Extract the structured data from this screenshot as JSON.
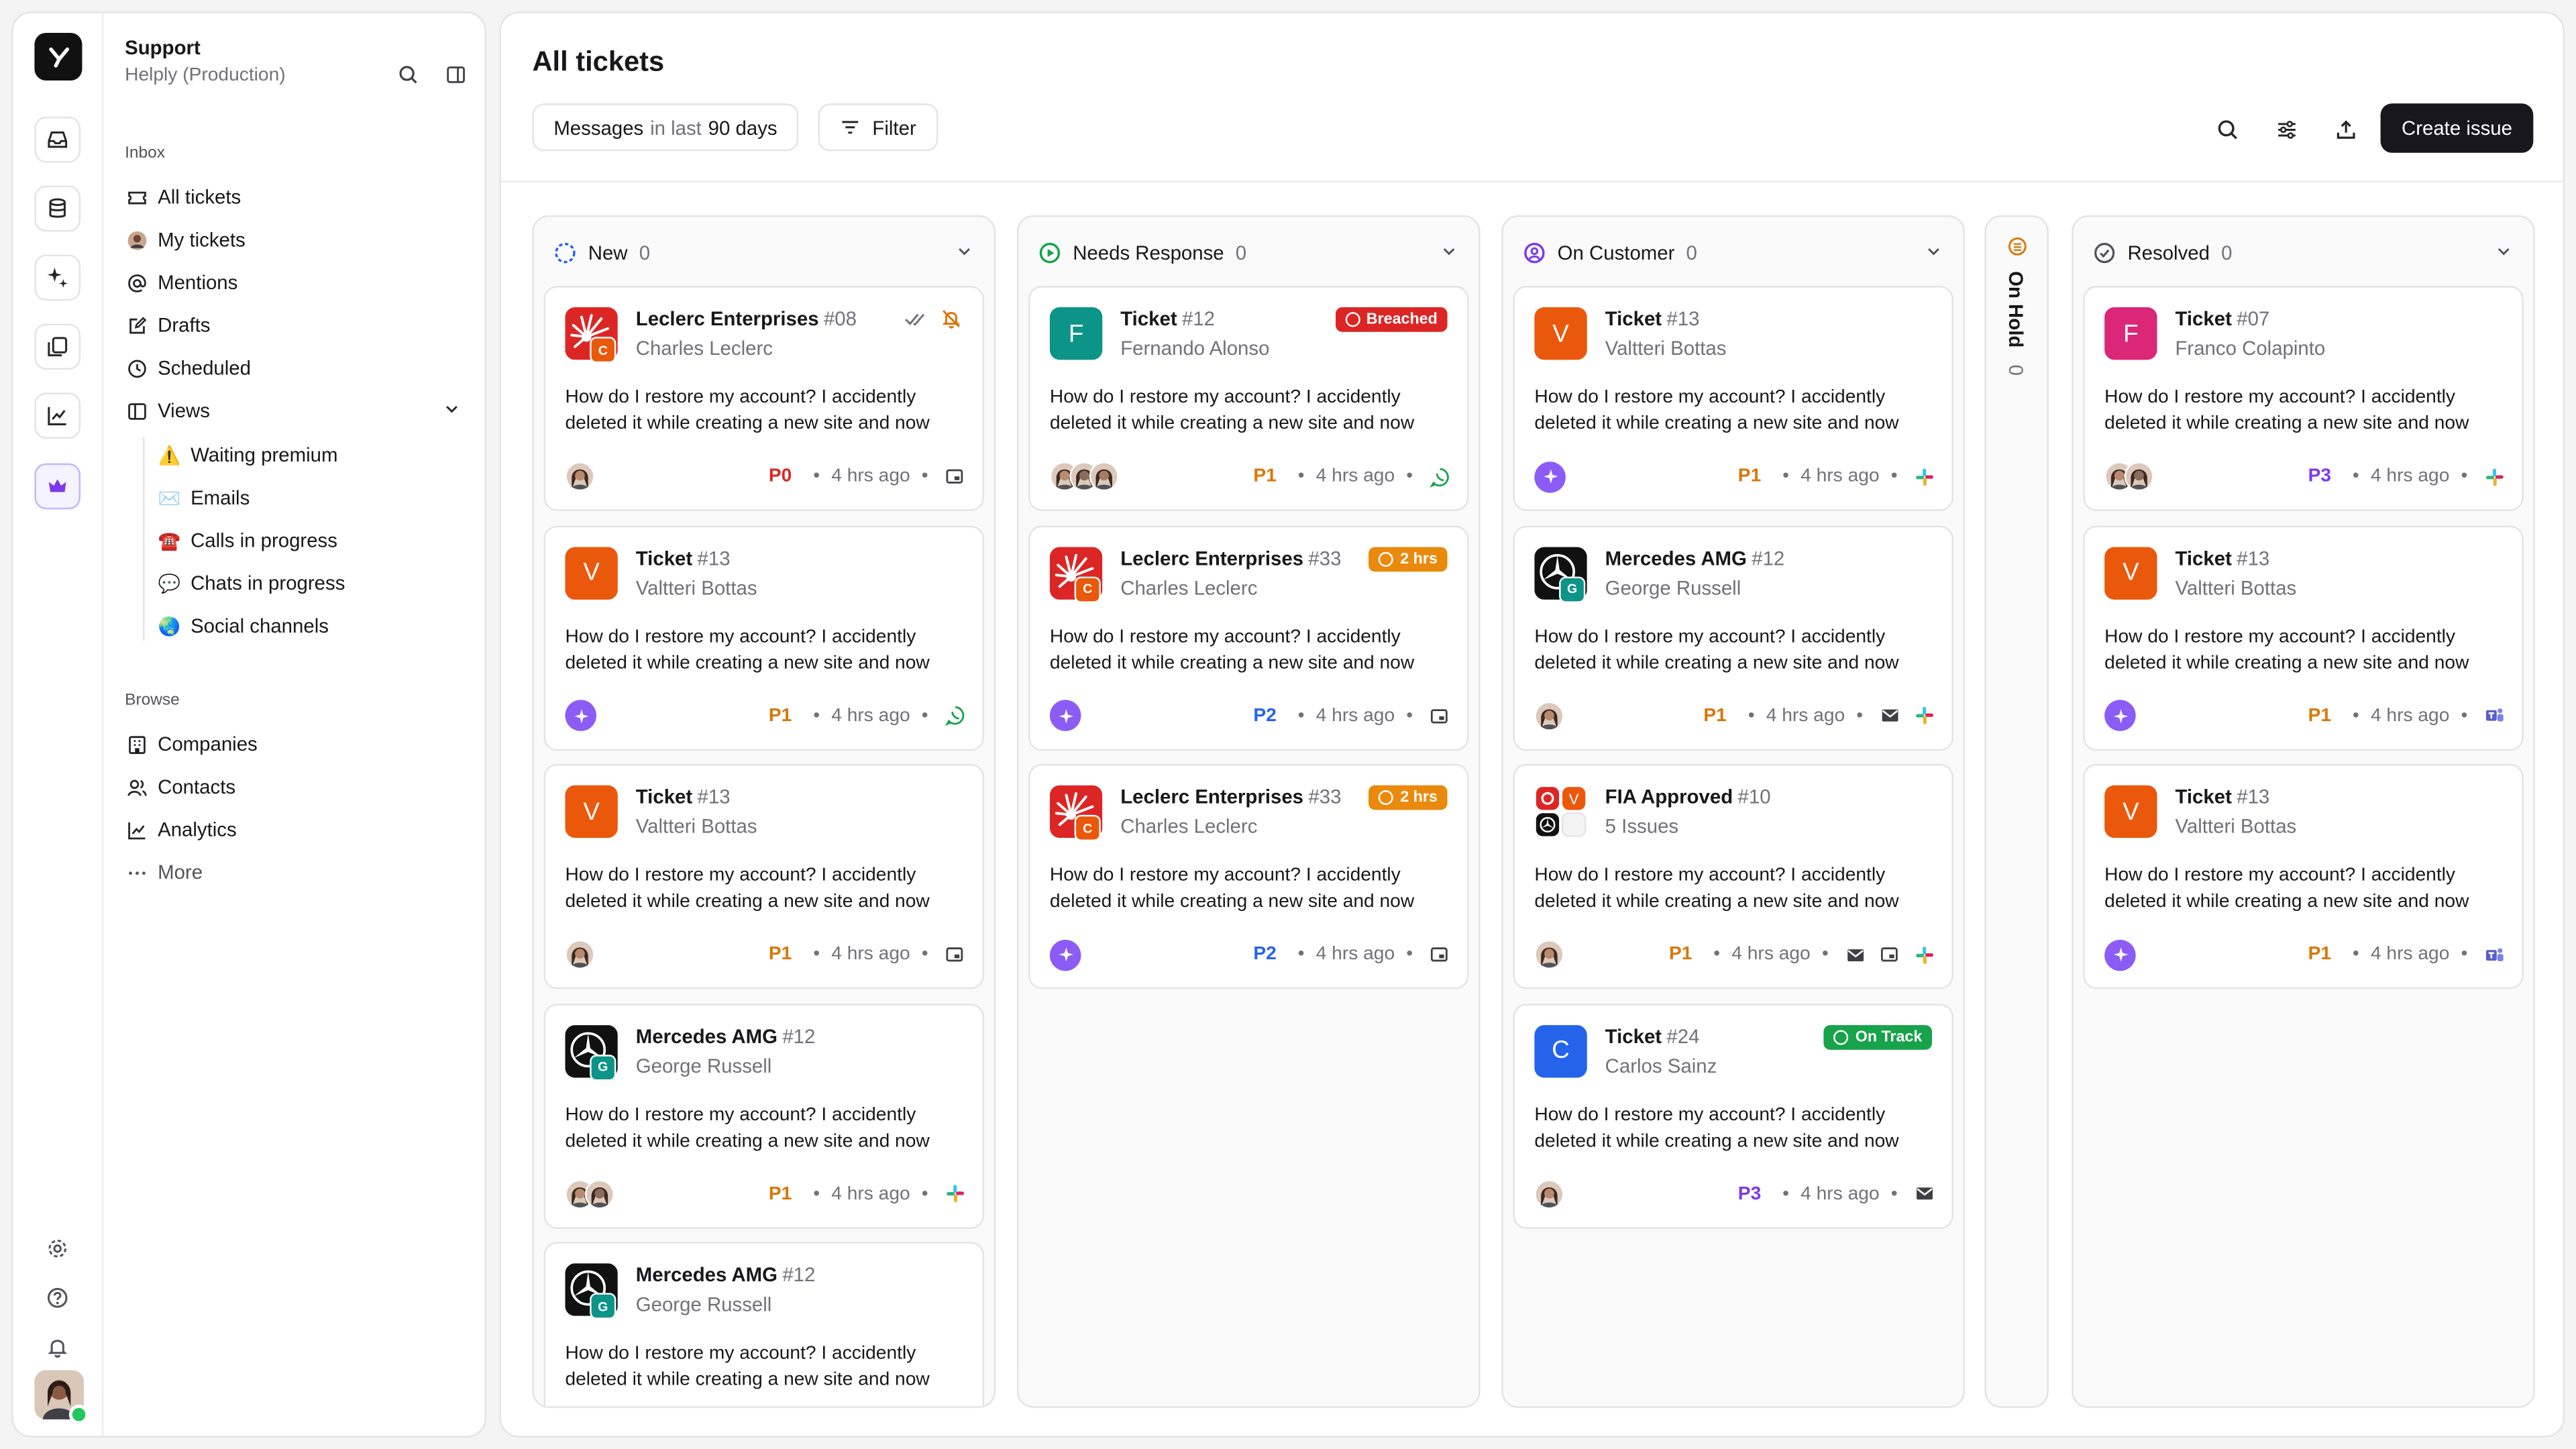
{
  "workspace": {
    "title": "Support",
    "subtitle": "Helply (Production)"
  },
  "nav": {
    "inbox_label": "Inbox",
    "inbox_items": [
      {
        "label": "All tickets",
        "icon": "ticket-icon"
      },
      {
        "label": "My tickets",
        "icon": "avatar-icon"
      },
      {
        "label": "Mentions",
        "icon": "at-icon"
      },
      {
        "label": "Drafts",
        "icon": "edit-icon"
      },
      {
        "label": "Scheduled",
        "icon": "clock-icon"
      },
      {
        "label": "Views",
        "icon": "columns-icon"
      }
    ],
    "views": [
      {
        "label": "Waiting premium",
        "emoji": "⚠️"
      },
      {
        "label": "Emails",
        "emoji": "✉️"
      },
      {
        "label": "Calls in progress",
        "emoji": "☎️"
      },
      {
        "label": "Chats in progress",
        "emoji": "💬"
      },
      {
        "label": "Social channels",
        "emoji": "🌏"
      }
    ],
    "browse_label": "Browse",
    "browse_items": [
      {
        "label": "Companies",
        "icon": "building-icon"
      },
      {
        "label": "Contacts",
        "icon": "users-icon"
      },
      {
        "label": "Analytics",
        "icon": "chart-icon"
      },
      {
        "label": "More",
        "icon": "more-icon"
      }
    ]
  },
  "header": {
    "title": "All tickets",
    "filter_prefix": "Messages",
    "filter_mid": "in last",
    "filter_value": "90 days",
    "filter_label": "Filter",
    "create_label": "Create issue"
  },
  "colors": {
    "p0": "#dc2626",
    "p1": "#d97706",
    "p2": "#2563eb",
    "p3": "#7c3aed",
    "breached": "#dc2626",
    "time": "#ea8a0c",
    "ontrack": "#16a34a",
    "accent": "#8b5cf6"
  },
  "columns": [
    {
      "name": "New",
      "count": "0",
      "icon": "new-status-icon",
      "cards": [
        {
          "title": "Leclerc Enterprises",
          "num": "#08",
          "sub": "Charles Leclerc",
          "avatar": "logo-leclerc",
          "sub_letter": "C",
          "sub_color": "#ea580c",
          "body": "How do I restore my account? I accidently deleted it while creating a new site and now",
          "people": 1,
          "priority": "P0",
          "pc": "#dc2626",
          "time": "4 hrs ago",
          "channels": [
            "chat-icon"
          ],
          "actions": true
        },
        {
          "title": "Ticket",
          "num": "#13",
          "sub": "Valtteri Bottas",
          "avatar": "letter",
          "letter": "V",
          "color": "#ea580c",
          "body": "How do I restore my account? I accidently deleted it while creating a new site and now",
          "ai": true,
          "priority": "P1",
          "pc": "#d97706",
          "time": "4 hrs ago",
          "channels": [
            "whatsapp-icon"
          ]
        },
        {
          "title": "Ticket",
          "num": "#13",
          "sub": "Valtteri Bottas",
          "avatar": "letter",
          "letter": "V",
          "color": "#ea580c",
          "body": "How do I restore my account? I accidently deleted it while creating a new site and now",
          "people": 1,
          "priority": "P1",
          "pc": "#d97706",
          "time": "4 hrs ago",
          "channels": [
            "chat-icon"
          ]
        },
        {
          "title": "Mercedes AMG",
          "num": "#12",
          "sub": "George Russell",
          "avatar": "logo-mercedes",
          "sub_letter": "G",
          "sub_color": "#0d9488",
          "body": "How do I restore my account? I accidently deleted it while creating a new site and now",
          "people": 2,
          "priority": "P1",
          "pc": "#d97706",
          "time": "4 hrs ago",
          "channels": [
            "slack-icon"
          ]
        },
        {
          "title": "Mercedes AMG",
          "num": "#12",
          "sub": "George Russell",
          "avatar": "logo-mercedes",
          "sub_letter": "G",
          "sub_color": "#0d9488",
          "body": "How do I restore my account? I accidently deleted it while creating a new site and now",
          "people": 0,
          "priority": "",
          "pc": "#d97706",
          "time": "",
          "channels": []
        }
      ]
    },
    {
      "name": "Needs Response",
      "count": "0",
      "icon": "needs-response-icon",
      "cards": [
        {
          "title": "Ticket",
          "num": "#12",
          "sub": "Fernando Alonso",
          "avatar": "letter",
          "letter": "F",
          "color": "#0d9488",
          "body": "How do I restore my account? I accidently deleted it while creating a new site and now",
          "people": 3,
          "priority": "P1",
          "pc": "#d97706",
          "time": "4 hrs ago",
          "channels": [
            "whatsapp-icon"
          ],
          "badge": "Breached",
          "badge_color": "#dc2626"
        },
        {
          "title": "Leclerc Enterprises",
          "num": "#33",
          "sub": "Charles Leclerc",
          "avatar": "logo-leclerc",
          "sub_letter": "C",
          "sub_color": "#ea580c",
          "body": "How do I restore my account? I accidently deleted it while creating a new site and now",
          "ai": true,
          "priority": "P2",
          "pc": "#2563eb",
          "time": "4 hrs ago",
          "channels": [
            "chat-icon"
          ],
          "badge": "2 hrs",
          "badge_color": "#ea8a0c"
        },
        {
          "title": "Leclerc Enterprises",
          "num": "#33",
          "sub": "Charles Leclerc",
          "avatar": "logo-leclerc",
          "sub_letter": "C",
          "sub_color": "#ea580c",
          "body": "How do I restore my account? I accidently deleted it while creating a new site and now",
          "ai": true,
          "priority": "P2",
          "pc": "#2563eb",
          "time": "4 hrs ago",
          "channels": [
            "chat-icon"
          ],
          "badge": "2 hrs",
          "badge_color": "#ea8a0c"
        }
      ]
    },
    {
      "name": "On Customer",
      "count": "0",
      "icon": "on-customer-icon",
      "cards": [
        {
          "title": "Ticket",
          "num": "#13",
          "sub": "Valtteri Bottas",
          "avatar": "letter",
          "letter": "V",
          "color": "#ea580c",
          "body": "How do I restore my account? I accidently deleted it while creating a new site and now",
          "ai": true,
          "priority": "P1",
          "pc": "#d97706",
          "time": "4 hrs ago",
          "channels": [
            "slack-icon"
          ]
        },
        {
          "title": "Mercedes AMG",
          "num": "#12",
          "sub": "George Russell",
          "avatar": "logo-mercedes",
          "sub_letter": "G",
          "sub_color": "#0d9488",
          "body": "How do I restore my account? I accidently deleted it while creating a new site and now",
          "people": 1,
          "priority": "P1",
          "pc": "#d97706",
          "time": "4 hrs ago",
          "channels": [
            "mail-icon",
            "slack-icon"
          ]
        },
        {
          "title": "FIA Approved",
          "num": "#10",
          "sub": "5 Issues",
          "avatar": "logo-fia",
          "body": "How do I restore my account? I accidently deleted it while creating a new site and now",
          "people": 1,
          "priority": "P1",
          "pc": "#d97706",
          "time": "4 hrs ago",
          "channels": [
            "mail-icon",
            "chat-icon",
            "slack-icon"
          ]
        },
        {
          "title": "Ticket",
          "num": "#24",
          "sub": "Carlos Sainz",
          "avatar": "letter",
          "letter": "C",
          "color": "#2563eb",
          "body": "How do I restore my account? I accidently deleted it while creating a new site and now",
          "people": 1,
          "priority": "P3",
          "pc": "#7c3aed",
          "time": "4 hrs ago",
          "channels": [
            "mail-icon"
          ],
          "badge": "On Track",
          "badge_color": "#16a34a"
        }
      ]
    },
    {
      "name": "Resolved",
      "count": "0",
      "icon": "resolved-icon",
      "cards": [
        {
          "title": "Ticket",
          "num": "#07",
          "sub": "Franco Colapinto",
          "avatar": "letter",
          "letter": "F",
          "color": "#db2777",
          "body": "How do I restore my account? I accidently deleted it while creating a new site and now",
          "people": 2,
          "priority": "P3",
          "pc": "#7c3aed",
          "time": "4 hrs ago",
          "channels": [
            "slack-icon"
          ]
        },
        {
          "title": "Ticket",
          "num": "#13",
          "sub": "Valtteri Bottas",
          "avatar": "letter",
          "letter": "V",
          "color": "#ea580c",
          "body": "How do I restore my account? I accidently deleted it while creating a new site and now",
          "ai": true,
          "priority": "P1",
          "pc": "#d97706",
          "time": "4 hrs ago",
          "channels": [
            "teams-icon"
          ]
        },
        {
          "title": "Ticket",
          "num": "#13",
          "sub": "Valtteri Bottas",
          "avatar": "letter",
          "letter": "V",
          "color": "#ea580c",
          "body": "How do I restore my account? I accidently deleted it while creating a new site and now",
          "ai": true,
          "priority": "P1",
          "pc": "#d97706",
          "time": "4 hrs ago",
          "channels": [
            "teams-icon"
          ]
        }
      ]
    }
  ],
  "on_hold": {
    "name": "On Hold",
    "count": "0"
  }
}
